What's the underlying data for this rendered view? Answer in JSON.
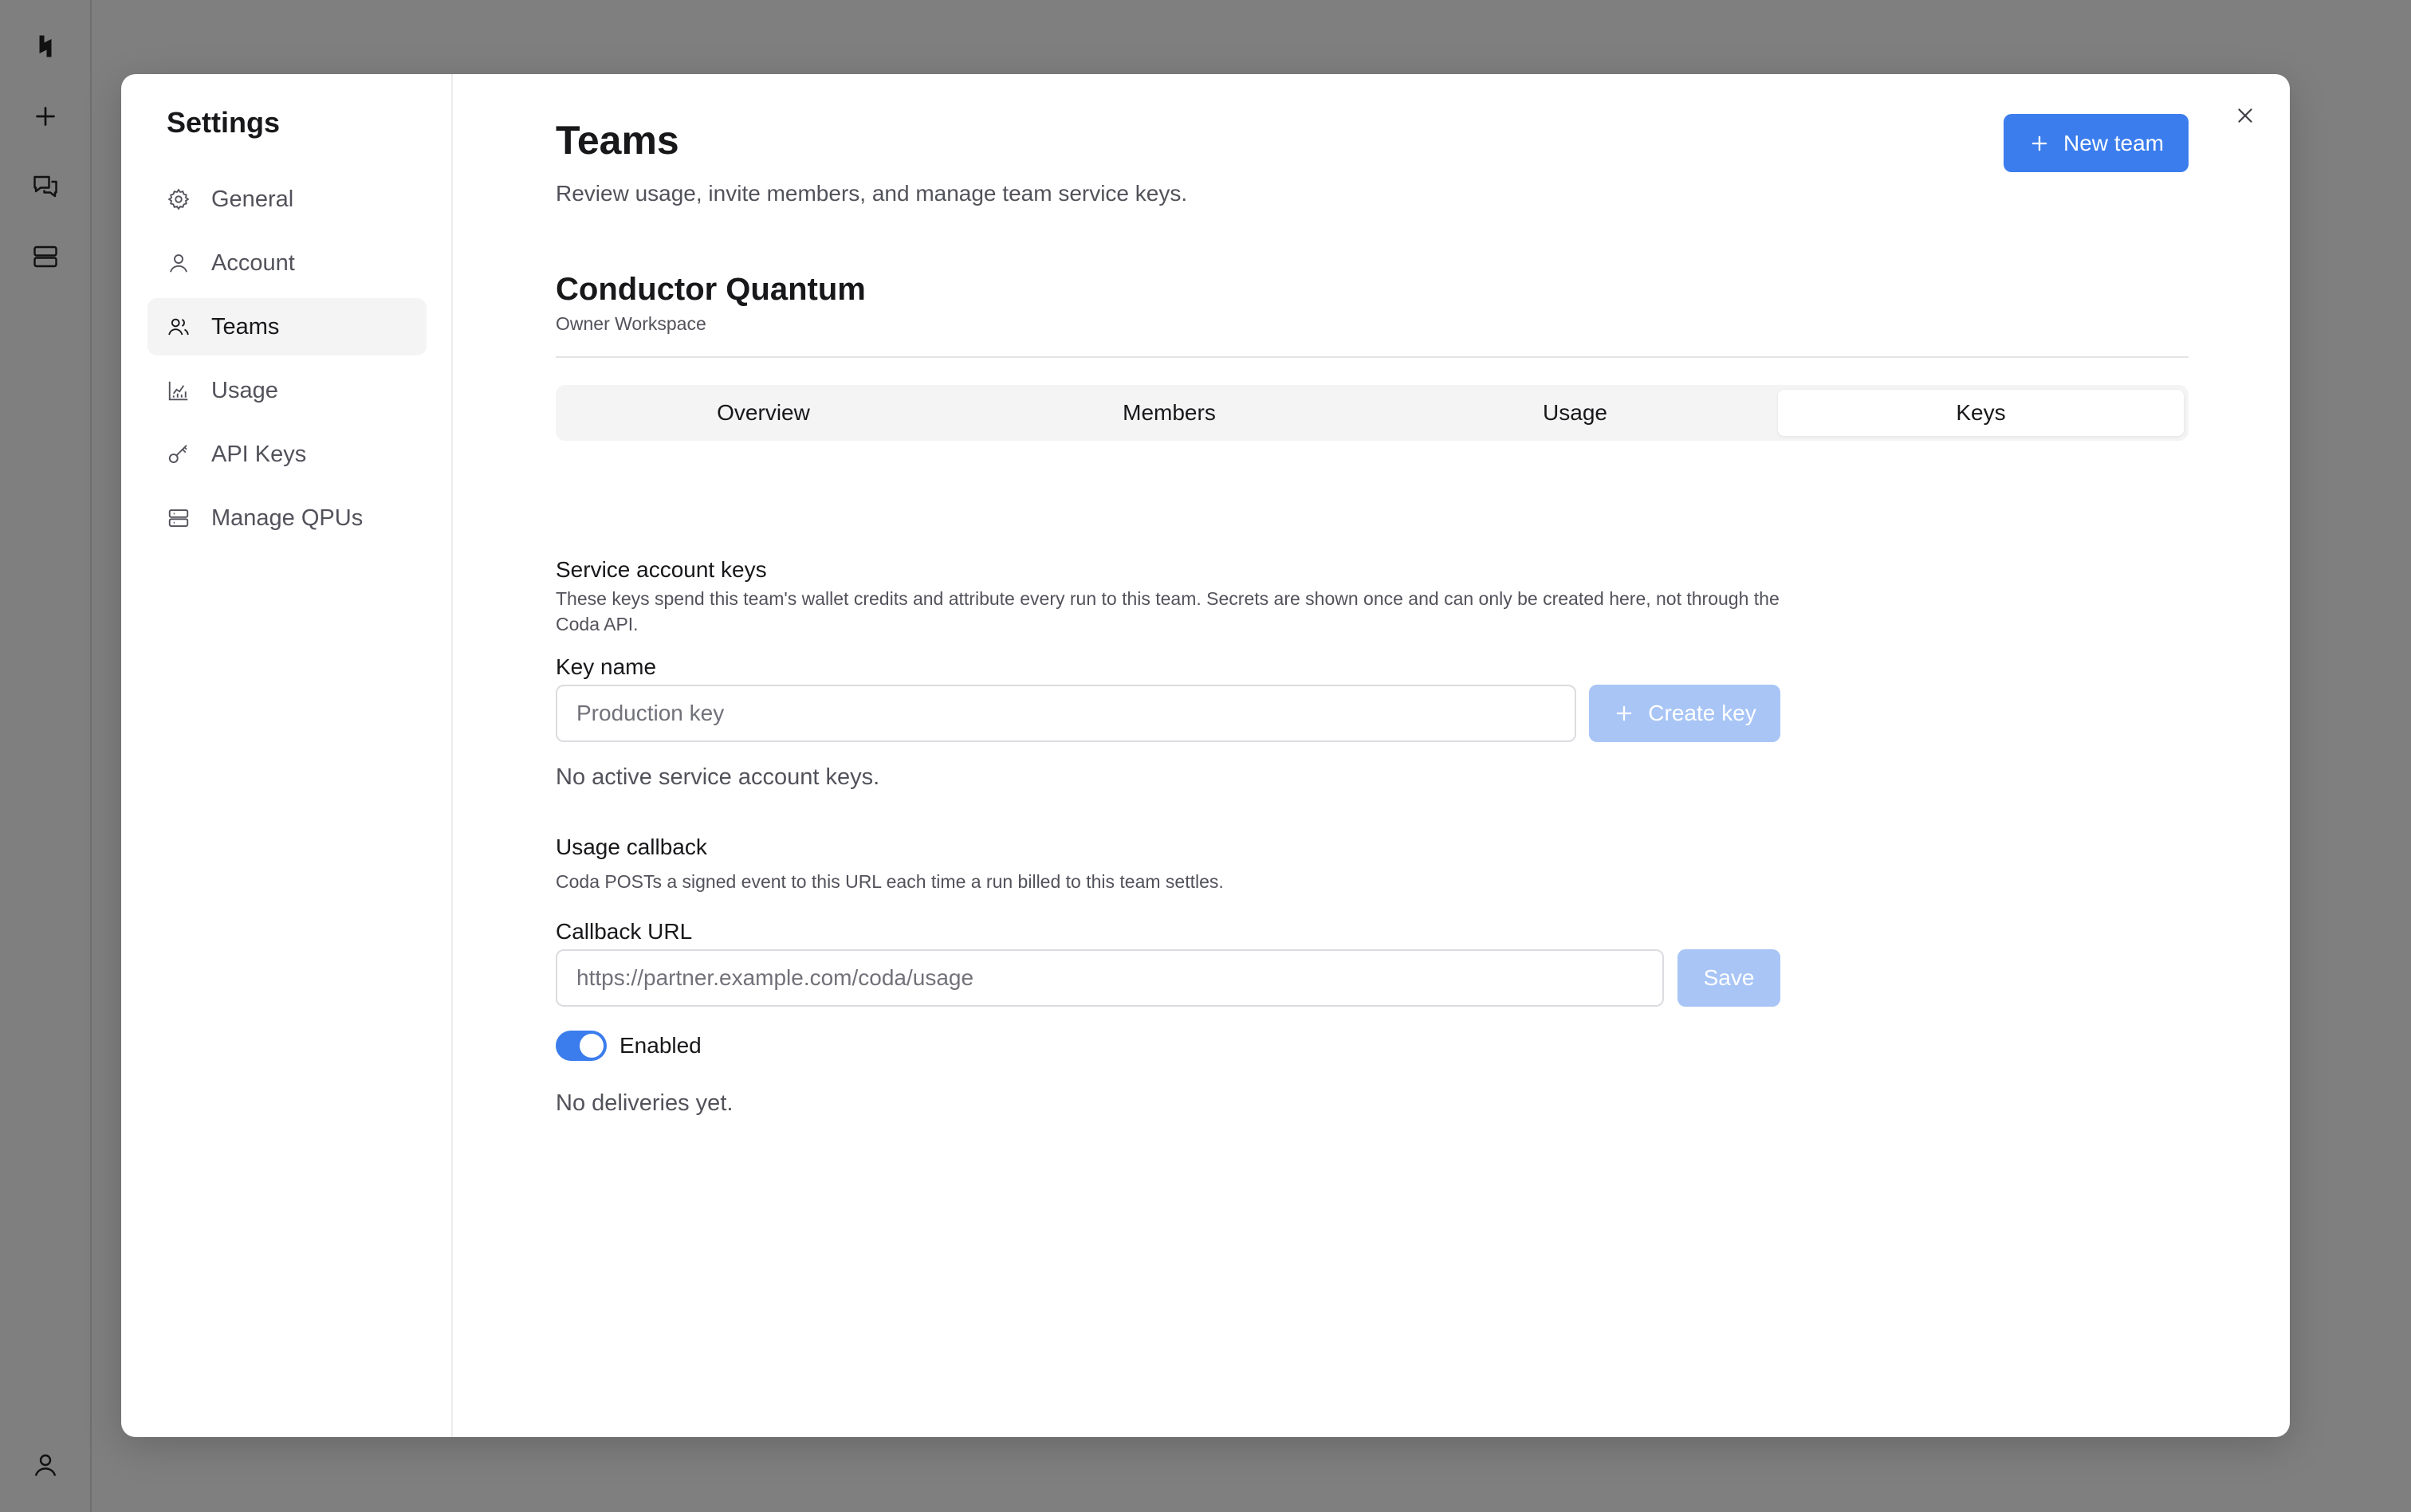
{
  "rail": {
    "icons": [
      "logo-icon",
      "plus-icon",
      "chat-icon",
      "server-icon",
      "user-icon"
    ]
  },
  "settings": {
    "title": "Settings",
    "nav": [
      {
        "label": "General",
        "icon": "gear-icon"
      },
      {
        "label": "Account",
        "icon": "user-icon"
      },
      {
        "label": "Teams",
        "icon": "users-icon",
        "active": true
      },
      {
        "label": "Usage",
        "icon": "chart-icon"
      },
      {
        "label": "API Keys",
        "icon": "key-icon"
      },
      {
        "label": "Manage QPUs",
        "icon": "server-icon"
      }
    ]
  },
  "page": {
    "title": "Teams",
    "subtitle": "Review usage, invite members, and manage team service keys.",
    "new_team_label": "New team"
  },
  "team": {
    "name": "Conductor Quantum",
    "role": "Owner Workspace"
  },
  "tabs": [
    {
      "label": "Overview"
    },
    {
      "label": "Members"
    },
    {
      "label": "Usage"
    },
    {
      "label": "Keys",
      "active": true
    }
  ],
  "keys": {
    "section_title": "Service account keys",
    "description": "These keys spend this team's wallet credits and attribute every run to this team. Secrets are shown once and can only be created here, not through the Coda API.",
    "field_label": "Key name",
    "placeholder": "Production key",
    "value": "",
    "create_label": "Create key",
    "empty_text": "No active service account keys."
  },
  "callback": {
    "section_title": "Usage callback",
    "description": "Coda POSTs a signed event to this URL each time a run billed to this team settles.",
    "field_label": "Callback URL",
    "placeholder": "https://partner.example.com/coda/usage",
    "value": "",
    "save_label": "Save",
    "toggle_label": "Enabled",
    "toggle_on": true,
    "empty_text": "No deliveries yet."
  },
  "colors": {
    "accent": "#3b7ded",
    "accent_disabled": "#a8c5f6",
    "overlay": "#7f7f7f"
  }
}
